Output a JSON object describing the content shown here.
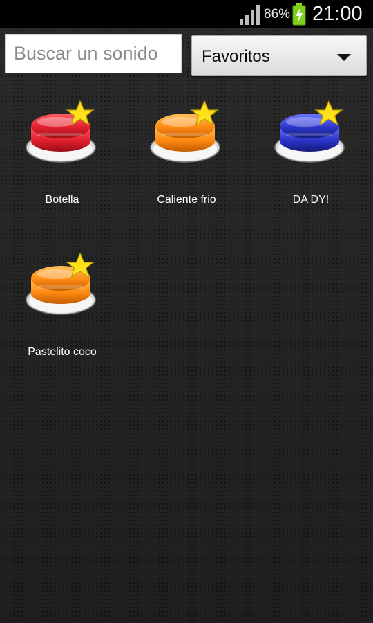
{
  "status_bar": {
    "battery_percent": "86%",
    "time": "21:00",
    "signal_icon": "signal-bars-icon",
    "battery_icon": "battery-charging-icon"
  },
  "search": {
    "placeholder": "Buscar un sonido"
  },
  "filter": {
    "selected": "Favoritos",
    "icon": "dropdown-arrow-icon"
  },
  "sounds": [
    {
      "label": "Botella",
      "color": "#e2202e",
      "favorite": true,
      "icon": "red-button-icon"
    },
    {
      "label": "Caliente frio",
      "color": "#ff8a12",
      "favorite": true,
      "icon": "orange-button-icon"
    },
    {
      "label": "DA DY!",
      "color": "#2b35c9",
      "favorite": true,
      "icon": "blue-button-icon"
    },
    {
      "label": "Pastelito coco",
      "color": "#ff8a12",
      "favorite": true,
      "icon": "orange-button-icon"
    }
  ]
}
